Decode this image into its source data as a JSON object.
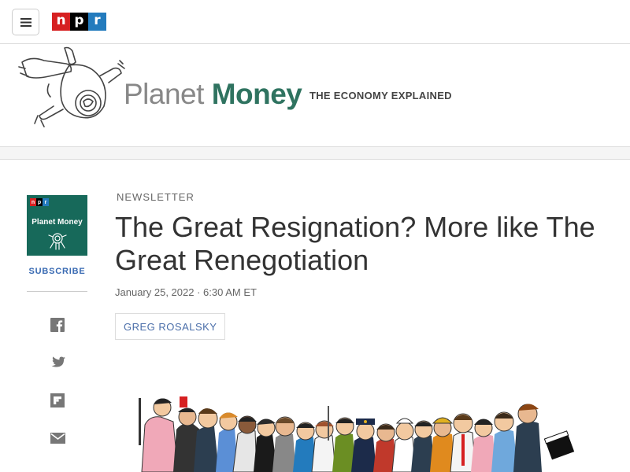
{
  "header": {
    "menu_icon": "hamburger-menu-icon",
    "logo": {
      "n": "n",
      "p": "p",
      "r": "r"
    }
  },
  "program": {
    "name_part1": "Planet",
    "name_part2": "Money",
    "tagline": "THE ECONOMY EXPLAINED",
    "colors": {
      "brand_green": "#2f7360",
      "planet_gray": "#888888"
    }
  },
  "rail": {
    "tile_title": "Planet Money",
    "subscribe_label": "SUBSCRIBE",
    "share_icons": [
      "facebook-icon",
      "twitter-icon",
      "flipboard-icon",
      "email-icon"
    ]
  },
  "article": {
    "slug": "Newsletter",
    "headline": "The Great Resignation? More like The Great Renegotiation",
    "date": "January 25, 2022",
    "time": "6:30 AM ET",
    "author": "Greg Rosalsky"
  }
}
